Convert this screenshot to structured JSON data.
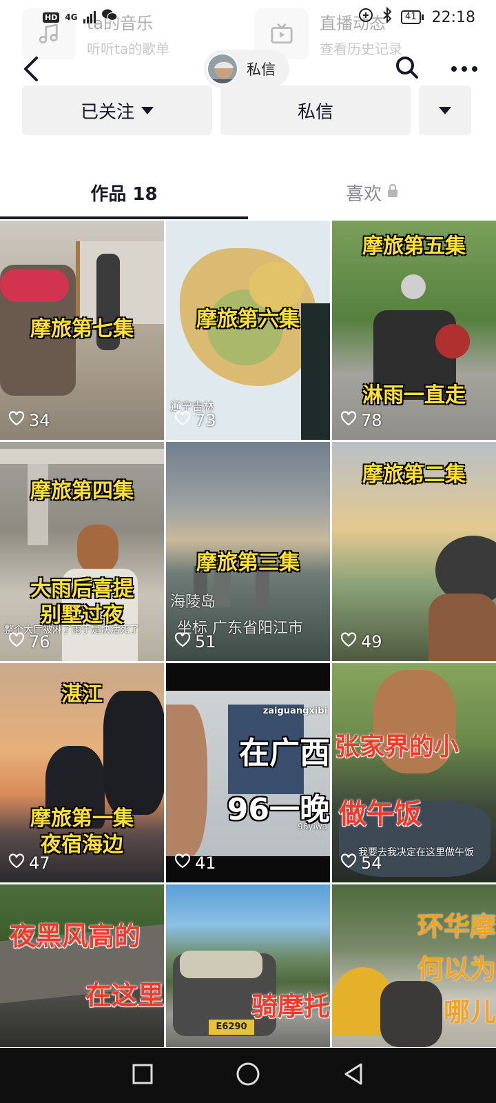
{
  "status": {
    "hd": "HD",
    "network": "4G",
    "battery": "41",
    "time": "22:18"
  },
  "shelf": [
    {
      "title": "ta的音乐",
      "subtitle": "听听ta的歌单"
    },
    {
      "title": "直播动态",
      "subtitle": "查看历史记录"
    }
  ],
  "header": {
    "chip_label": "私信"
  },
  "actions": {
    "follow_label": "已关注",
    "message_label": "私信"
  },
  "tabs": [
    {
      "label": "作品 18"
    },
    {
      "label": "喜欢"
    }
  ],
  "videos": [
    {
      "caption": "摩旅第七集",
      "likes": "34"
    },
    {
      "caption": "摩旅第六集",
      "overlay": "辽宁吉林",
      "likes": "73"
    },
    {
      "caption": "摩旅第五集",
      "caption2": "淋雨一直走",
      "likes": "78"
    },
    {
      "caption": "摩旅第四集",
      "caption2": "大雨后喜提",
      "caption3": "别墅过夜",
      "overlay": "整个大厅被淋了雨于是快活死了",
      "likes": "76"
    },
    {
      "caption": "摩旅第三集",
      "overlay": "海陵岛",
      "overlay2": "坐标 广东省阳江市",
      "likes": "51"
    },
    {
      "caption": "摩旅第二集",
      "likes": "49"
    },
    {
      "caption": "湛江",
      "caption2": "摩旅第一集",
      "caption3": "夜宿海边",
      "likes": "47"
    },
    {
      "caption": "在广西",
      "caption2": "96一晚",
      "overlay": "zaiguangxibi",
      "overlay2": "96yiwa",
      "likes": "41"
    },
    {
      "caption": "张家界的小",
      "caption2": "做午饭",
      "overlay": "我要去我决定在这里做午饭",
      "likes": "54"
    },
    {
      "caption": "夜黑风高的",
      "caption2": "在这里"
    },
    {
      "caption": "骑摩托",
      "overlay": "E6290"
    },
    {
      "caption": "环华摩",
      "caption2": "何以为",
      "caption3": "哪儿"
    }
  ],
  "colors": {
    "caption_yellow": "#ffe03a",
    "caption_red": "#f03a2a",
    "active_tab": "#161823",
    "inactive_tab": "#8a8b91"
  },
  "icons": [
    "back-icon",
    "search-icon",
    "more-icon",
    "heart-icon",
    "lock-icon",
    "music-icon",
    "tv-icon",
    "home-icon",
    "recents-icon"
  ]
}
